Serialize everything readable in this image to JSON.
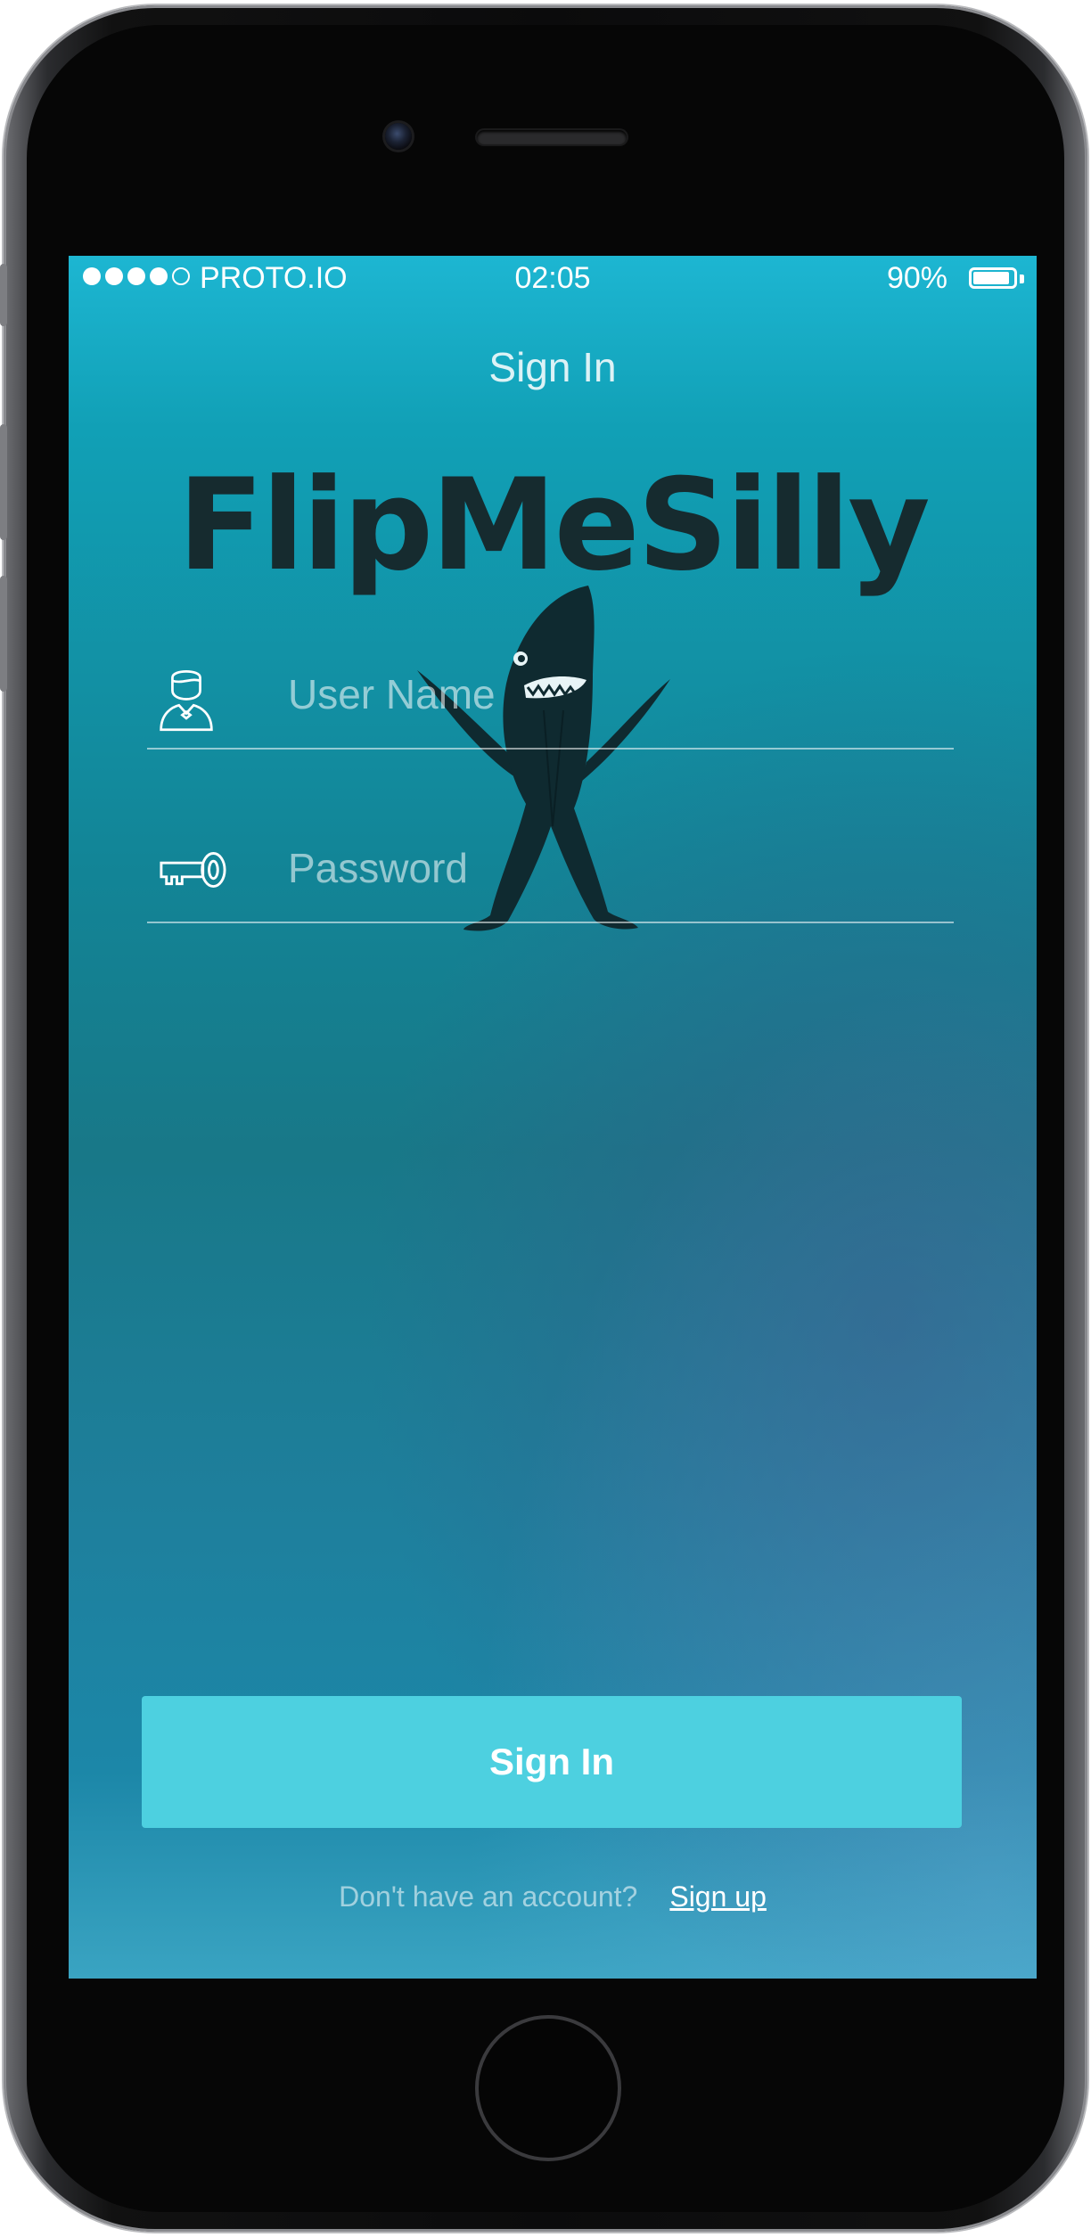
{
  "status_bar": {
    "carrier": "PROTO.IO",
    "time": "02:05",
    "battery_percent": "90%",
    "signal_bars_filled": 4,
    "signal_bars_total": 5
  },
  "header": {
    "title": "Sign In"
  },
  "logo": {
    "text": "FlipMeSilly",
    "mascot_icon": "shark-mascot-icon"
  },
  "form": {
    "username": {
      "placeholder": "User Name",
      "value": "",
      "icon": "user-icon"
    },
    "password": {
      "placeholder": "Password",
      "value": "",
      "icon": "key-icon"
    }
  },
  "actions": {
    "sign_in_label": "Sign In"
  },
  "footer": {
    "prompt": "Don't have an account?",
    "signup_label": "Sign up"
  },
  "colors": {
    "button": "#4dd0e0",
    "logo_text": "#162b2f",
    "gradient_top": "#1db6d2",
    "gradient_mid": "#187888"
  }
}
